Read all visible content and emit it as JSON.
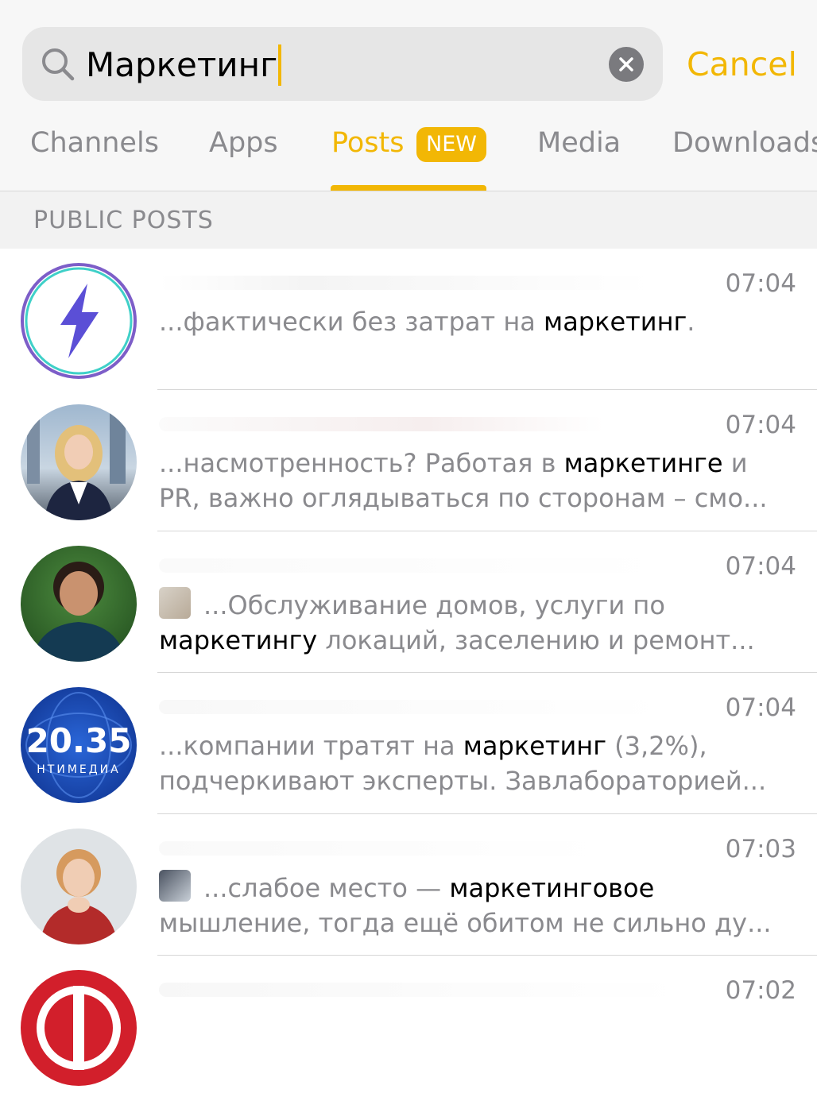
{
  "search": {
    "query": "Маркетинг",
    "cancel_label": "Cancel"
  },
  "tabs": [
    {
      "label": "Channels"
    },
    {
      "label": "Apps"
    },
    {
      "label": "Posts",
      "badge": "NEW",
      "active": true
    },
    {
      "label": "Media"
    },
    {
      "label": "Downloads"
    }
  ],
  "section": {
    "title": "PUBLIC POSTS"
  },
  "posts": [
    {
      "time": "07:04",
      "line1_pre": "...фактически без затрат на ",
      "line1_hl": "маркетинг",
      "line1_post": "."
    },
    {
      "time": "07:04",
      "line1_pre": "...насмотренность?  Работая в ",
      "line1_hl": "маркетинге",
      "line1_post": " и",
      "line2": "PR, важно оглядываться по сторонам – смо..."
    },
    {
      "time": "07:04",
      "line1_pre": "...Обслуживание домов, услуги по",
      "line2_hl": "маркетингу",
      "line2_post": " локаций, заселению и ремонт..."
    },
    {
      "time": "07:04",
      "avatar_text_main": "20.35",
      "avatar_text_sub": "НТИМЕДИА",
      "line1_pre": "...компании тратят на ",
      "line1_hl": "маркетинг",
      "line1_post": " (3,2%),",
      "line2": "подчеркивают эксперты. Завлабораторией..."
    },
    {
      "time": "07:03",
      "line1_pre": "...слабое место — ",
      "line1_hl": "маркетинговое",
      "line2": "мышление, тогда ещё обитом не сильно ду..."
    },
    {
      "time": "07:02"
    }
  ],
  "colors": {
    "accent": "#f2b705",
    "secondary_text": "#8a8a8e"
  }
}
